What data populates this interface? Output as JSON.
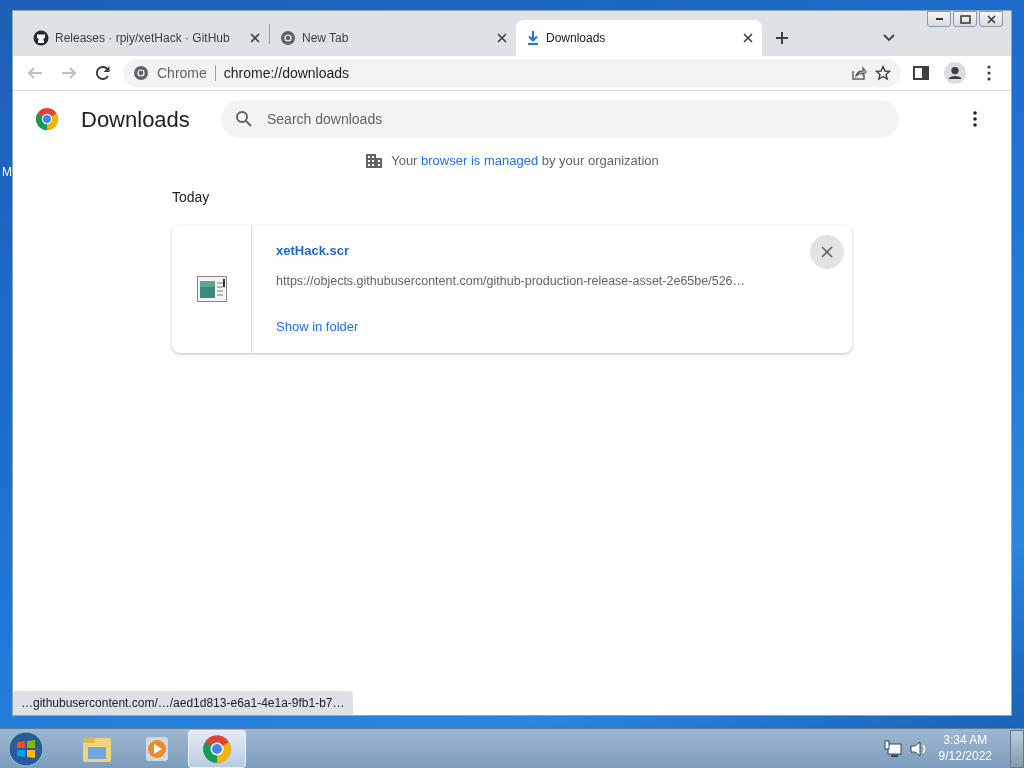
{
  "desktop": {
    "label": "M"
  },
  "window": {
    "tabs": [
      {
        "title": "Releases · rpiy/xetHack · GitHub",
        "kind": "github",
        "selected": false
      },
      {
        "title": "New Tab",
        "kind": "chrome",
        "selected": false
      },
      {
        "title": "Downloads",
        "kind": "download",
        "selected": true
      }
    ],
    "address_bar": {
      "chip": "Chrome",
      "url": "chrome://downloads"
    },
    "page": {
      "title": "Downloads",
      "search": {
        "placeholder": "Search downloads"
      },
      "managed_notice": {
        "before": "Your",
        "link": "browser is managed",
        "after": "by your organization"
      },
      "groups": [
        {
          "date": "Today",
          "items": [
            {
              "file_name": "xetHack.scr",
              "url": "https://objects.githubusercontent.com/github-production-release-asset-2e65be/526…",
              "action": "Show in folder"
            }
          ]
        }
      ]
    },
    "status_url": "…githubusercontent.com/…/aed1d813-e6a1-4e1a-9fb1-b7…"
  },
  "taskbar": {
    "items": [
      {
        "kind": "explorer",
        "selected": false
      },
      {
        "kind": "media",
        "selected": false
      },
      {
        "kind": "chrome",
        "selected": true
      }
    ],
    "clock": {
      "time": "3:34 AM",
      "date": "9/12/2022"
    }
  }
}
